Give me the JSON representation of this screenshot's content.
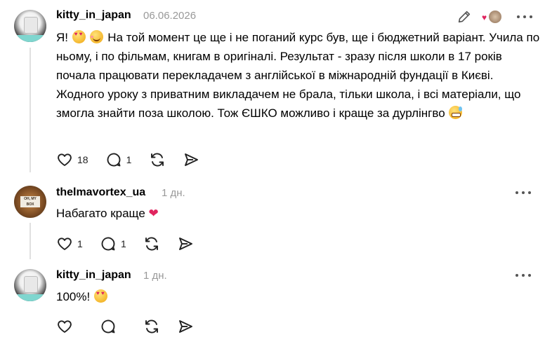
{
  "posts": [
    {
      "username": "kitty_in_japan",
      "time": "06.06.2026",
      "text_before": "Я!",
      "text_after": " На той момент це ще і не поганий курс був, ще і бюджетний варіант. Учила по ньому, і по фільмам, книгам в оригіналі. Результат - зразу після школи в 17 років почала працювати перекладачем з англійської в міжнародній фундації в Києві. Жодного уроку з приватним викладачем не брала, тільки школа, і всі матеріали, що змогла знайти поза школою. Тож ЄШКО можливо і краще за дурлінгво",
      "likes": "18",
      "replies": "1"
    },
    {
      "username": "thelmavortex_ua",
      "time": "1 дн.",
      "text": "Набагато краще",
      "likes": "1",
      "replies": "1"
    },
    {
      "username": "kitty_in_japan",
      "time": "1 дн.",
      "text": "100%!",
      "likes": "",
      "replies": ""
    }
  ],
  "icons": {
    "like": "heart-outline-icon",
    "reply": "speech-bubble-icon",
    "repost": "repost-arrows-icon",
    "share": "send-paper-plane-icon",
    "edit": "pencil-icon",
    "more": "ellipsis-icon"
  },
  "colors": {
    "accent_heart": "#e0245e",
    "muted": "#999999"
  }
}
